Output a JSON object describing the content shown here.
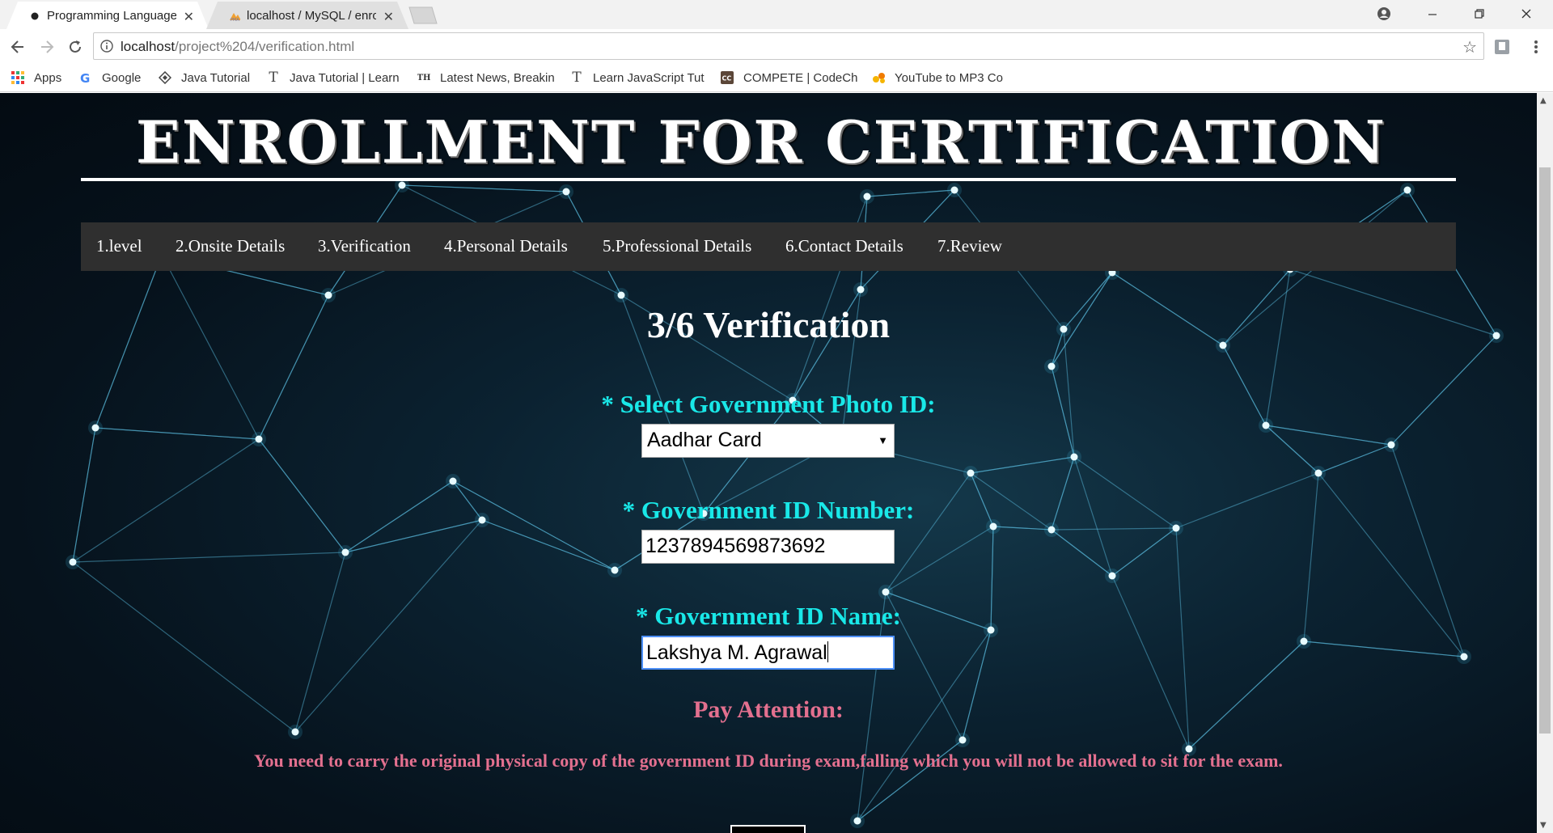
{
  "browser": {
    "tabs": [
      {
        "title": "Programming Languages",
        "active": true
      },
      {
        "title": "localhost / MySQL / enro",
        "active": false
      }
    ],
    "address": {
      "host": "localhost",
      "path": "/project%204/verification.html"
    },
    "bookmarks": [
      {
        "label": "Apps",
        "icon": "apps-grid-icon"
      },
      {
        "label": "Google",
        "icon": "google-icon"
      },
      {
        "label": "Java Tutorial",
        "icon": "java-tutorial-icon"
      },
      {
        "label": "Java Tutorial | Learn",
        "icon": "text-t-icon"
      },
      {
        "label": "Latest News, Breakin",
        "icon": "th-icon"
      },
      {
        "label": "Learn JavaScript Tut",
        "icon": "text-t-icon"
      },
      {
        "label": "COMPETE | CodeChe",
        "icon": "codechef-icon"
      },
      {
        "label": "YouTube to MP3 Co",
        "icon": "yt-mp3-icon"
      }
    ]
  },
  "page": {
    "title": "ENROLLMENT FOR CERTIFICATION",
    "nav": [
      "1.level",
      "2.Onsite Details",
      "3.Verification",
      "4.Personal Details",
      "5.Professional Details",
      "6.Contact Details",
      "7.Review"
    ],
    "step_heading": "3/6 Verification",
    "fields": {
      "photo_id_label": "* Select Government Photo ID:",
      "photo_id_value": "Aadhar Card",
      "id_number_label": "* Government ID Number:",
      "id_number_value": "1237894569873692",
      "id_name_label": "* Government ID Name:",
      "id_name_value": "Lakshya M. Agrawal"
    },
    "attention": {
      "heading": "Pay Attention:",
      "text": "You need to carry the original physical copy of the government ID during exam,falling which you will not be allowed to sit for the exam."
    }
  },
  "colors": {
    "label_cyan": "#19e8e8",
    "attention_pink": "#e3708f",
    "nav_background": "#2f2f2f"
  }
}
